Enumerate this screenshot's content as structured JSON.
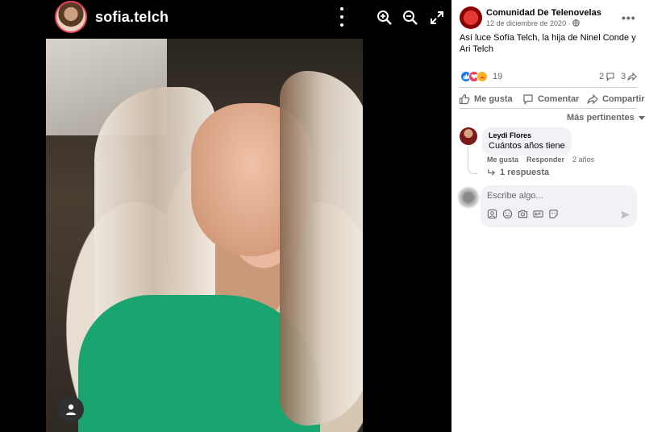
{
  "viewer": {
    "username": "sofia.telch"
  },
  "post": {
    "page_name": "Comunidad De Telenovelas",
    "date": "12 de diciembre de 2020 ·",
    "caption": "Así luce Sofía Telch, la hija de Ninel Conde y Ari Telch",
    "reaction_count": "19",
    "comment_count": "2",
    "share_count": "3",
    "actions": {
      "like": "Me gusta",
      "comment": "Comentar",
      "share": "Compartir"
    },
    "sort_label": "Más pertinentes"
  },
  "comment": {
    "author": "Leydi Flores",
    "text": "Cuántos años tiene",
    "like": "Me gusta",
    "reply": "Responder",
    "time": "2 años",
    "replies": "1 respuesta"
  },
  "composer": {
    "placeholder": "Escribe algo..."
  },
  "colors": {
    "accent": "#1877f2",
    "muted": "#65676b",
    "bubble": "#f0f2f5",
    "shirt": "#1aa46f"
  }
}
